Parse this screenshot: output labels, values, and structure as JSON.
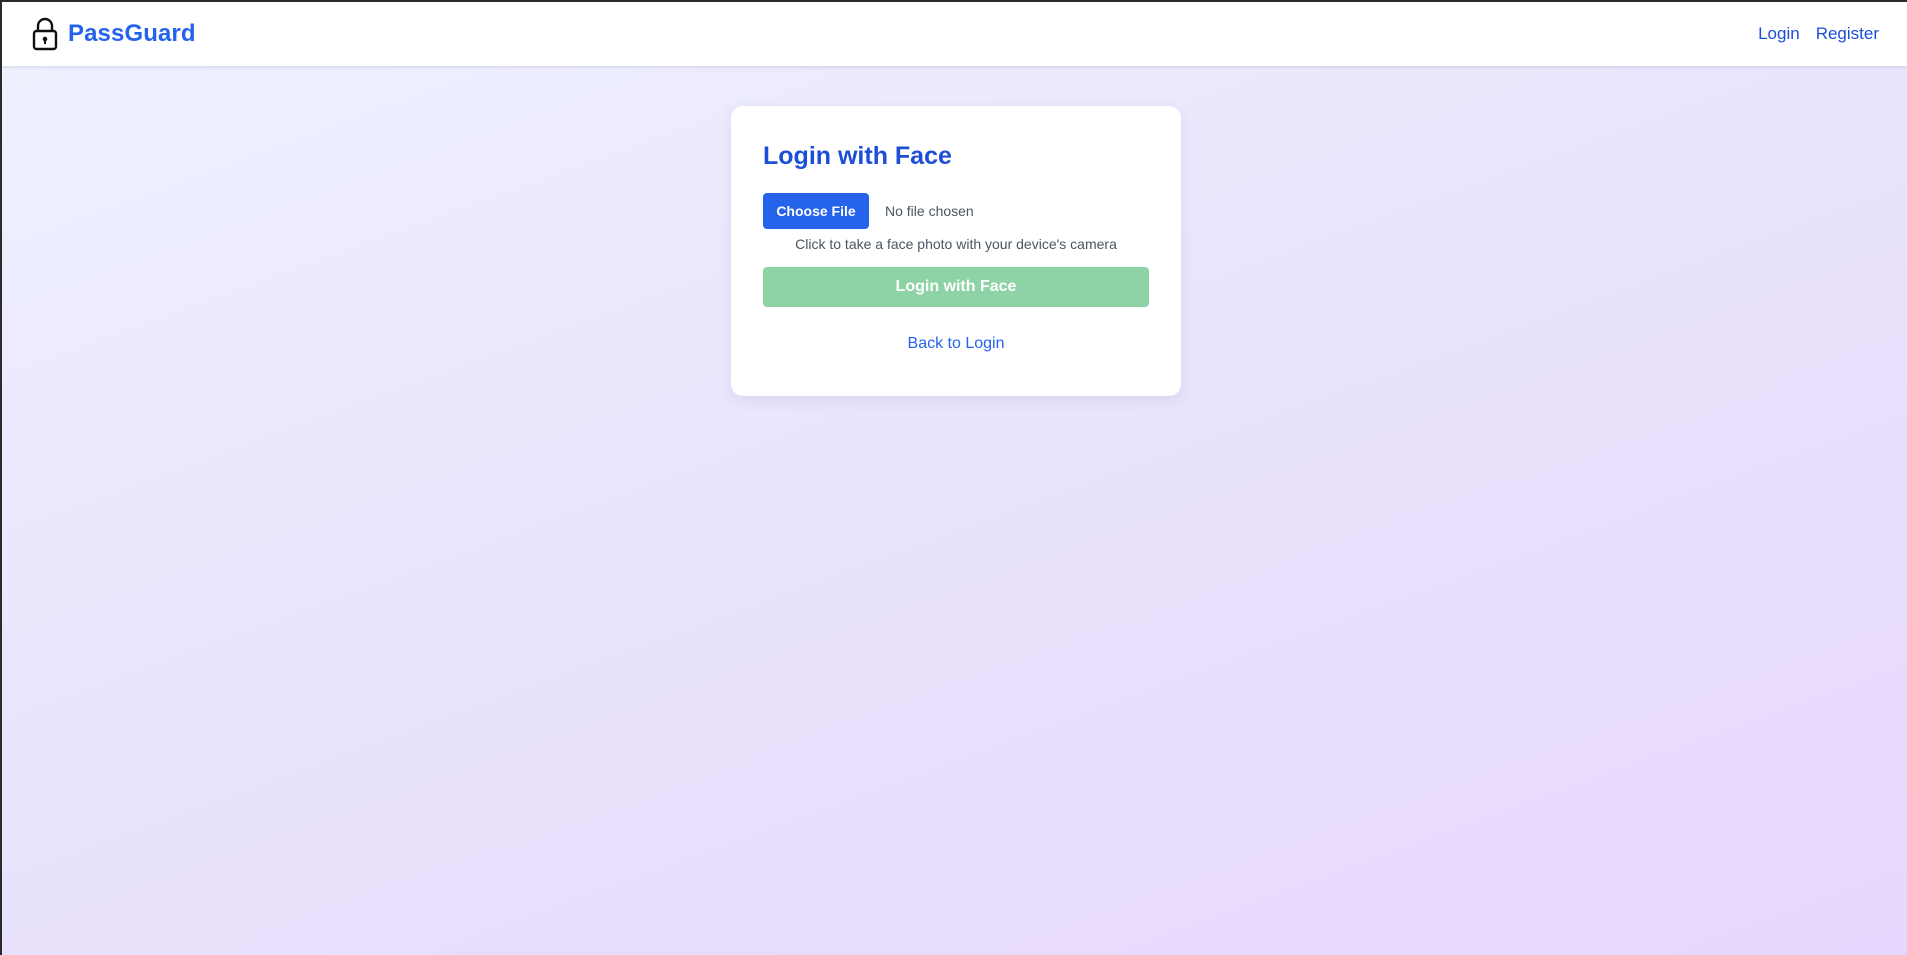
{
  "header": {
    "brand_name": "PassGuard",
    "logo_icon": "lock-icon",
    "nav": {
      "login_label": "Login",
      "register_label": "Register"
    }
  },
  "card": {
    "title": "Login with Face",
    "file_input": {
      "button_label": "Choose File",
      "status_text": "No file chosen"
    },
    "hint_text": "Click to take a face photo with your device's camera",
    "submit_label": "Login with Face",
    "submit_disabled": true,
    "back_link_label": "Back to Login"
  },
  "colors": {
    "brand": "#2563eb",
    "title": "#1d4ed8",
    "submit_disabled_bg": "#8dd3a5"
  }
}
